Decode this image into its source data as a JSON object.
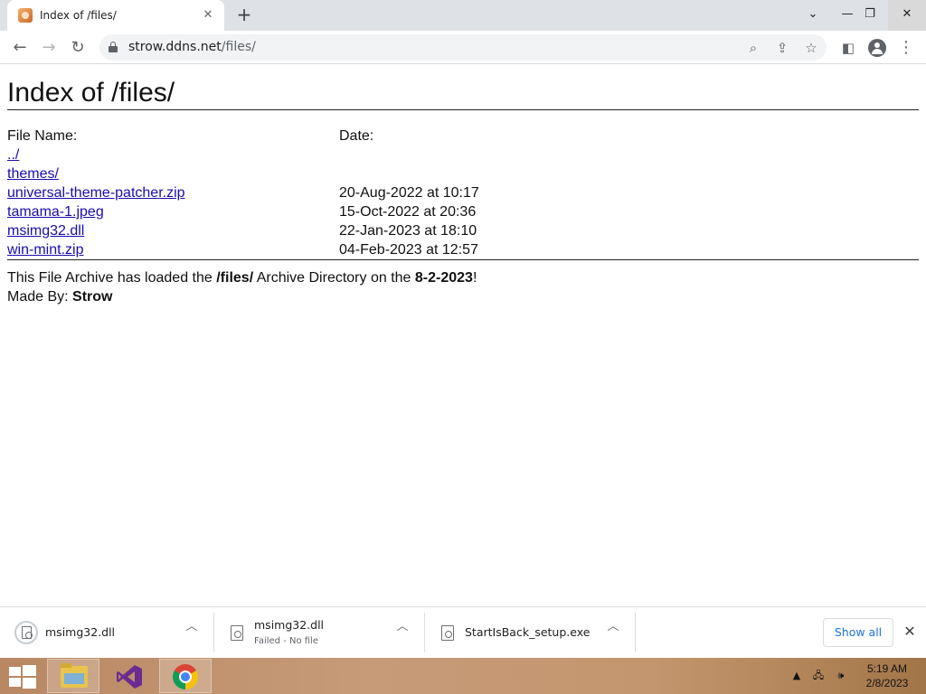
{
  "browser": {
    "tab_title": "Index of /files/",
    "url_host": "strow.ddns.net",
    "url_path": "/files/"
  },
  "page": {
    "title": "Index of /files/",
    "col_name": "File Name:",
    "col_date": "Date:",
    "files": [
      {
        "name": "../",
        "date": ""
      },
      {
        "name": "themes/",
        "date": ""
      },
      {
        "name": "universal-theme-patcher.zip",
        "date": "20-Aug-2022 at 10:17"
      },
      {
        "name": "tamama-1.jpeg",
        "date": "15-Oct-2022 at 20:36"
      },
      {
        "name": "msimg32.dll",
        "date": "22-Jan-2023 at 18:10"
      },
      {
        "name": "win-mint.zip",
        "date": "04-Feb-2023 at 12:57"
      }
    ],
    "footer": {
      "line1_a": "This File Archive has loaded the ",
      "line1_b": "/files/",
      "line1_c": " Archive Directory on the ",
      "line1_d": "8-2-2023",
      "line1_e": "!",
      "line2_a": "Made By: ",
      "line2_b": "Strow"
    }
  },
  "downloads": {
    "items": [
      {
        "name": "msimg32.dll",
        "status": ""
      },
      {
        "name": "msimg32.dll",
        "status": "Failed - No file"
      },
      {
        "name": "StartIsBack_setup.exe",
        "status": ""
      }
    ],
    "show_all": "Show all"
  },
  "taskbar": {
    "time": "5:19 AM",
    "date": "2/8/2023"
  }
}
